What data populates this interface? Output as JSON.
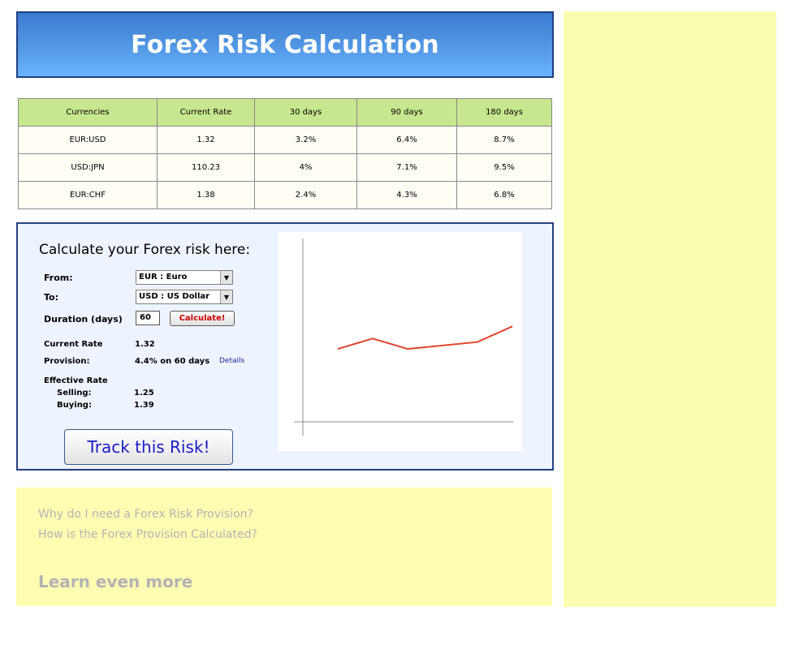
{
  "header": {
    "title": "Forex Risk Calculation"
  },
  "rates_table": {
    "columns": [
      "Currencies",
      "Current Rate",
      "30 days",
      "90 days",
      "180 days"
    ],
    "rows": [
      [
        "EUR:USD",
        "1.32",
        "3.2%",
        "6.4%",
        "8.7%"
      ],
      [
        "USD:JPN",
        "110.23",
        "4%",
        "7.1%",
        "9.5%"
      ],
      [
        "EUR:CHF",
        "1.38",
        "2.4%",
        "4.3%",
        "6.8%"
      ]
    ]
  },
  "calculator": {
    "title": "Calculate your Forex risk here:",
    "from_label": "From:",
    "from_value": "EUR : Euro",
    "to_label": "To:",
    "to_value": "USD : US Dollar",
    "duration_label": "Duration (days)",
    "duration_value": "60",
    "calculate_label": "Calculate!",
    "current_rate_label": "Current Rate",
    "current_rate_value": "1.32",
    "provision_label": "Provision:",
    "provision_value": "4.4% on 60 days",
    "details_label": "Details",
    "effective_rate_label": "Effective Rate",
    "selling_label": "Selling:",
    "selling_value": "1.25",
    "buying_label": "Buying:",
    "buying_value": "1.39",
    "track_label": "Track this Risk!"
  },
  "chart_data": {
    "type": "line",
    "title": "",
    "xlabel": "",
    "ylabel": "",
    "grid": false,
    "x": [
      1,
      2,
      3,
      4,
      5,
      6
    ],
    "series": [
      {
        "values": [
          0.42,
          0.48,
          0.42,
          0.44,
          0.46,
          0.55
        ],
        "color": "#e0452f"
      }
    ],
    "xlim": [
      0,
      6
    ],
    "ylim": [
      0,
      1
    ]
  },
  "faq": {
    "questions": [
      "Why do I need a Forex Risk Provision?",
      "How is the Forex Provision Calculated?"
    ],
    "more_label": "Learn even more"
  },
  "colors": {
    "header_gradient_top": "#3a7bd0",
    "header_gradient_bottom": "#6ab3ff",
    "table_header": "#c8e690",
    "calc_background": "#eef4ff",
    "faq_background": "#fdfdb2",
    "sidebar_background": "#fafdb0",
    "calculate_text": "#cc0000",
    "track_text": "#1a1ac8"
  }
}
